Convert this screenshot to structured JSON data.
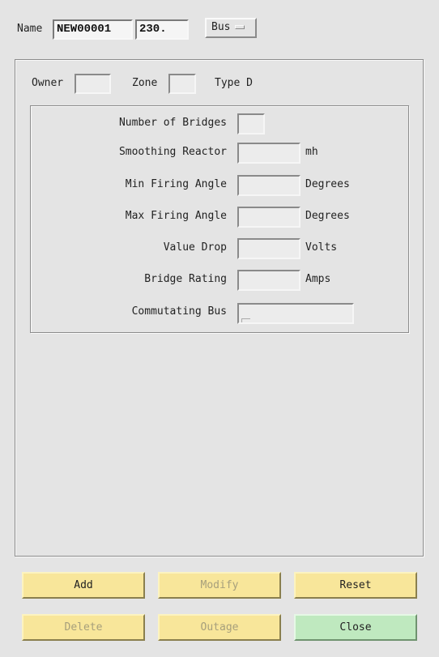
{
  "header": {
    "name_label": "Name",
    "name_value": "NEW00001",
    "voltage_value": "230.",
    "type_option": "Bus"
  },
  "ownership": {
    "owner_label": "Owner",
    "owner_value": "",
    "zone_label": "Zone",
    "zone_value": "",
    "type_label": "Type D"
  },
  "converter": {
    "bridges_label": "Number of Bridges",
    "bridges_value": "",
    "reactor_label": "Smoothing Reactor",
    "reactor_value": "",
    "reactor_unit": "mh",
    "min_angle_label": "Min Firing Angle",
    "min_angle_value": "",
    "min_angle_unit": "Degrees",
    "max_angle_label": "Max Firing Angle",
    "max_angle_value": "",
    "max_angle_unit": "Degrees",
    "valve_drop_label": "Value Drop",
    "valve_drop_value": "",
    "valve_drop_unit": "Volts",
    "bridge_rating_label": "Bridge Rating",
    "bridge_rating_value": "",
    "bridge_rating_unit": "Amps",
    "commutating_label": "Commutating Bus",
    "commutating_value": ""
  },
  "buttons": {
    "add": "Add",
    "modify": "Modify",
    "reset": "Reset",
    "delete": "Delete",
    "outage": "Outage",
    "close": "Close"
  },
  "colors": {
    "window_bg": "#e4e4e4",
    "button_yellow": "#f8e69a",
    "button_green": "#bfe9bf",
    "disabled_text": "#a69f7c"
  }
}
